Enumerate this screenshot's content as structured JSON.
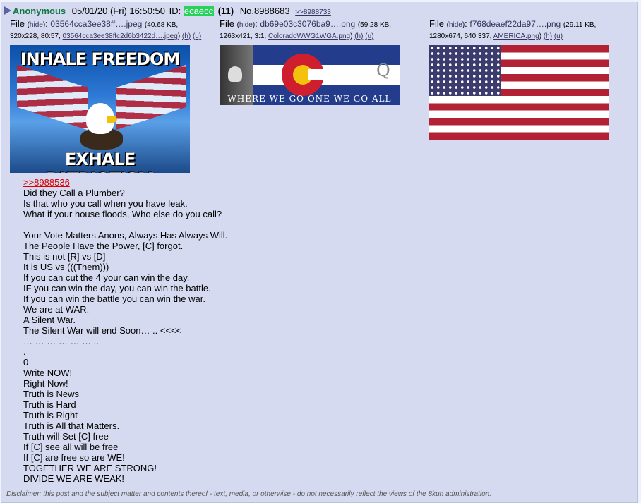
{
  "post": {
    "name": "Anonymous",
    "date": "05/01/20 (Fri) 16:50:50",
    "id_label": "ID:",
    "poster_id": "ecaecc",
    "reply_count": "(11)",
    "post_no": "No.8988683",
    "backlink": ">>8988733"
  },
  "files": [
    {
      "label": "File",
      "hide": "hide",
      "filename": "03564cca3ee38ff….jpeg",
      "size": "(40.68 KB,",
      "dims": "320x228, 80:57,",
      "orig": "03564cca3ee38ffc2d6b3422d….jpeg",
      "h": "(h)",
      "u": "(u)",
      "thumb_top": "INHALE FREEDOM",
      "thumb_bottom": "EXHALE PATRIOTISM"
    },
    {
      "label": "File",
      "hide": "hide",
      "filename": "db69e03c3076ba9….png",
      "size": "(59.28 KB,",
      "dims": "1263x421, 3:1,",
      "orig": "ColoradoWWG1WGA.png",
      "h": "(h)",
      "u": "(u)",
      "thumb_q": "Q",
      "thumb_caption": "WHERE WE GO ONE WE GO ALL"
    },
    {
      "label": "File",
      "hide": "hide",
      "filename": "f768deaef22da97….png",
      "size": "(29.11 KB,",
      "dims": "1280x674, 640:337,",
      "orig": "AMERICA.png",
      "h": "(h)",
      "u": "(u)"
    }
  ],
  "body": {
    "quote": ">>8988536",
    "lines": [
      "Did they Call a Plumber?",
      "Is that who you call when you have leak.",
      "What if your house floods, Who else do you call?",
      "",
      "Your Vote Matters Anons, Always Has Always Will.",
      "The People Have the Power, [C] forgot.",
      "This is not [R] vs [D]",
      "It is US vs (((Them)))",
      "If you can cut the 4 your can win the day.",
      "IF you can win the day, you can win the battle.",
      "If you can win the battle you can win the war.",
      "We are at WAR.",
      "A Silent War.",
      "The Silent War will end Soon… .. <<<<",
      "… … … … … … ..",
      ".",
      "0",
      "Write NOW!",
      "Right Now!",
      "Truth is News",
      "Truth is Hard",
      "Truth is Right",
      "Truth is All that Matters.",
      "Truth will Set [C] free",
      "If [C] see all will be free",
      "If [C] are free so are WE!",
      "TOGETHER WE ARE STRONG!",
      "DIVIDE WE ARE WEAK!"
    ]
  },
  "disclaimer": "Disclaimer: this post and the subject matter and contents thereof - text, media, or otherwise - do not necessarily reflect the views of the 8kun administration."
}
